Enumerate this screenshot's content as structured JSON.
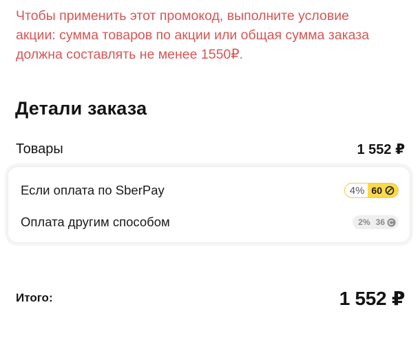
{
  "promo": {
    "warning": "Чтобы применить этот промокод, выполните условие\nакции: сумма товаров по акции или общая сумма заказа\nдолжна составлять не менее 1550₽."
  },
  "order": {
    "title": "Детали заказа",
    "goods_label": "Товары",
    "goods_amount": "1 552 ₽"
  },
  "payment_options": [
    {
      "label": "Если оплата по SberPay",
      "bonus_percent": "4%",
      "bonus_points": "60",
      "badge_color": "#fbd94a"
    },
    {
      "label": "Оплата другим способом",
      "bonus_percent": "2%",
      "bonus_points": "36",
      "badge_color": "#efefef"
    }
  ],
  "total": {
    "label": "Итого:",
    "amount": "1 552 ₽"
  },
  "colors": {
    "warning_text": "#d85555",
    "sber_badge": "#fbd94a"
  },
  "icons": {
    "bonus_coin": "bonus-coin-icon"
  }
}
